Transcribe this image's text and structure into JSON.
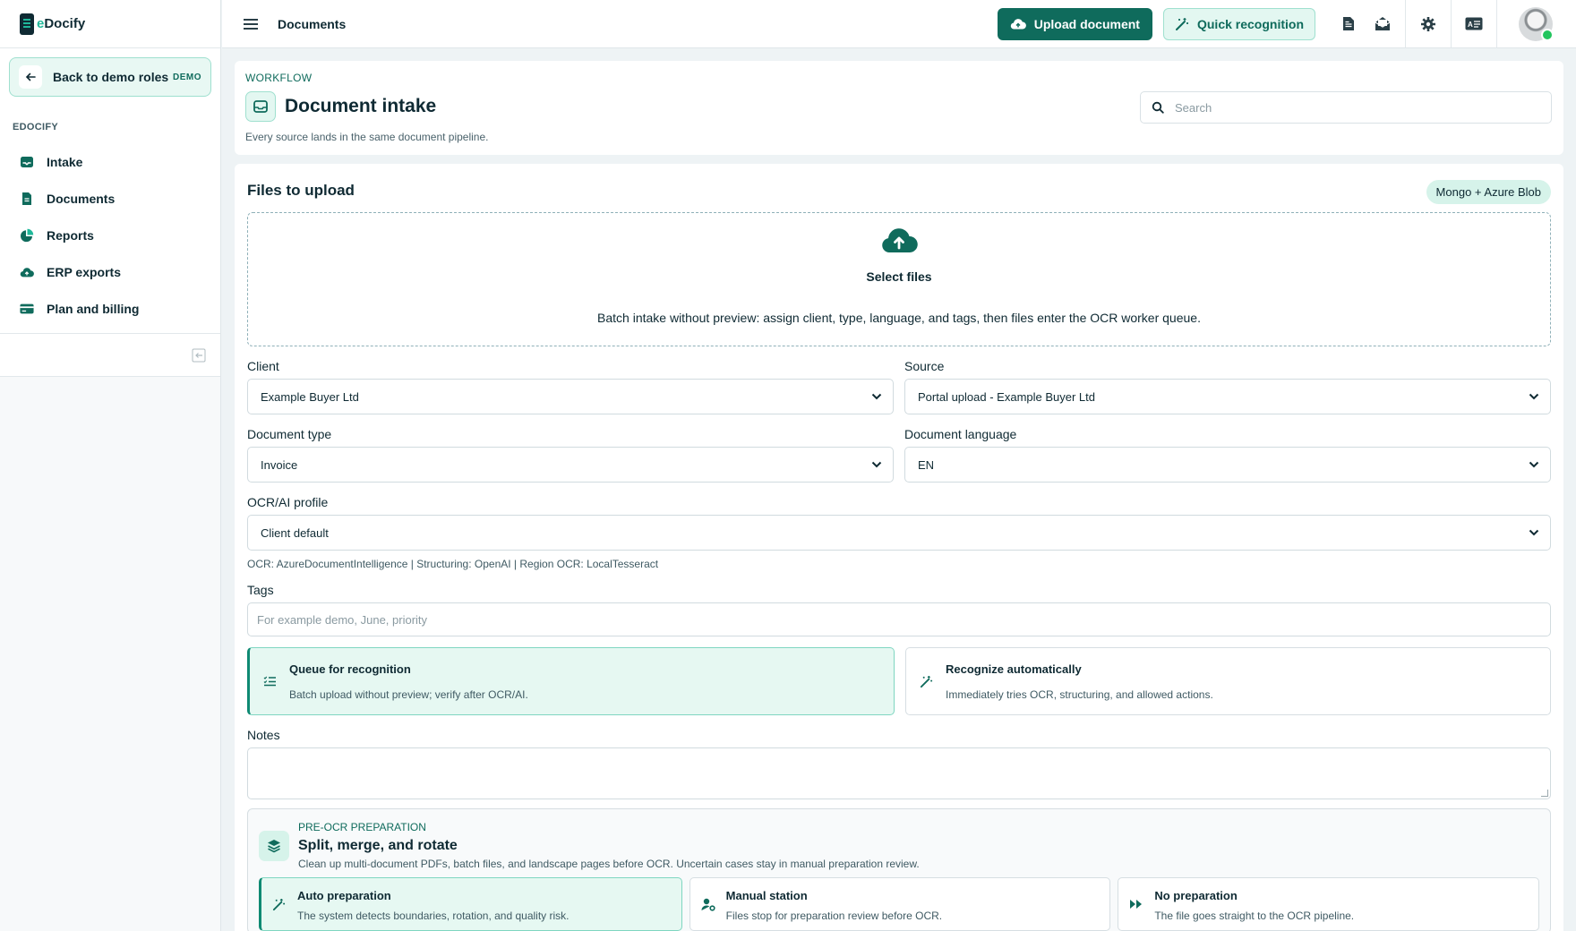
{
  "colors": {
    "accent": "#0f6b5c",
    "accent_light": "#e3f7f1",
    "brand_green": "#1fb89a",
    "text": "#0f2a33"
  },
  "brand": {
    "prefix": "e",
    "name": "Docify"
  },
  "sidebar": {
    "back_label": "Back to demo roles",
    "demo_badge": "DEMO",
    "section_title": "EDOCIFY",
    "items": [
      {
        "label": "Intake",
        "icon": "inbox-icon"
      },
      {
        "label": "Documents",
        "icon": "document-icon"
      },
      {
        "label": "Reports",
        "icon": "pie-chart-icon"
      },
      {
        "label": "ERP exports",
        "icon": "cloud-upload-icon"
      },
      {
        "label": "Plan and billing",
        "icon": "credit-card-icon"
      }
    ]
  },
  "topbar": {
    "title": "Documents",
    "upload_label": "Upload document",
    "quick_label": "Quick recognition"
  },
  "header": {
    "eyebrow": "WORKFLOW",
    "title": "Document intake",
    "subtitle": "Every source lands in the same document pipeline.",
    "search_placeholder": "Search"
  },
  "upload": {
    "title": "Files to upload",
    "storage_badge": "Mongo + Azure Blob",
    "dropzone_title": "Select files",
    "dropzone_desc": "Batch intake without preview: assign client, type, language, and tags, then files enter the OCR worker queue."
  },
  "form": {
    "client": {
      "label": "Client",
      "value": "Example Buyer Ltd"
    },
    "source": {
      "label": "Source",
      "value": "Portal upload - Example Buyer Ltd"
    },
    "doc_type": {
      "label": "Document type",
      "value": "Invoice"
    },
    "doc_language": {
      "label": "Document language",
      "value": "EN"
    },
    "ocr_profile": {
      "label": "OCR/AI profile",
      "value": "Client default"
    },
    "ocr_hint": "OCR: AzureDocumentIntelligence | Structuring: OpenAI | Region OCR: LocalTesseract",
    "tags": {
      "label": "Tags",
      "placeholder": "For example demo, June, priority"
    },
    "notes": {
      "label": "Notes"
    }
  },
  "modes": [
    {
      "title": "Queue for recognition",
      "desc": "Batch upload without preview; verify after OCR/AI.",
      "active": true
    },
    {
      "title": "Recognize automatically",
      "desc": "Immediately tries OCR, structuring, and allowed actions.",
      "active": false
    }
  ],
  "prep": {
    "eyebrow": "PRE-OCR PREPARATION",
    "title": "Split, merge, and rotate",
    "desc": "Clean up multi-document PDFs, batch files, and landscape pages before OCR. Uncertain cases stay in manual preparation review.",
    "options": [
      {
        "title": "Auto preparation",
        "desc": "The system detects boundaries, rotation, and quality risk."
      },
      {
        "title": "Manual station",
        "desc": "Files stop for preparation review before OCR."
      },
      {
        "title": "No preparation",
        "desc": "The file goes straight to the OCR pipeline."
      }
    ]
  }
}
